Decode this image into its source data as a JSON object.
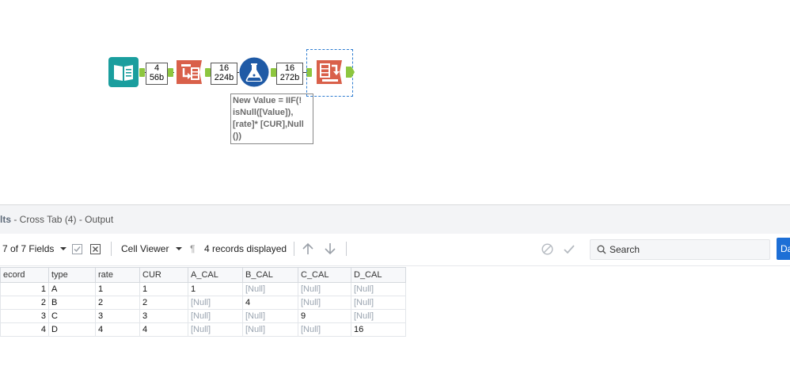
{
  "canvas": {
    "links": [
      {
        "records": "4",
        "size": "56b"
      },
      {
        "records": "16",
        "size": "224b"
      },
      {
        "records": "16",
        "size": "272b"
      }
    ],
    "annotation": "New Value = IIF(!\nisNull([Value]),\n[rate]* [CUR],Null\n())",
    "colors": {
      "input_tool": "#1a9e9e",
      "transform_tool": "#d9604a",
      "formula_tool": "#1f5aa6",
      "connector": "#8dc63f",
      "selection": "#2f7dd1"
    }
  },
  "results": {
    "title_prefix": "lts",
    "title_suffix": " - Cross Tab (4) - Output",
    "toolbar": {
      "fields": "7 of 7 Fields",
      "cell_viewer": "Cell Viewer",
      "records_displayed": "4 records displayed",
      "search_placeholder": "Search",
      "data_button": "Da"
    },
    "columns": [
      "ecord",
      "type",
      "rate",
      "CUR",
      "A_CAL",
      "B_CAL",
      "C_CAL",
      "D_CAL"
    ],
    "rows": [
      [
        "1",
        "A",
        "1",
        "1",
        "1",
        "[Null]",
        "[Null]",
        "[Null]"
      ],
      [
        "2",
        "B",
        "2",
        "2",
        "[Null]",
        "4",
        "[Null]",
        "[Null]"
      ],
      [
        "3",
        "C",
        "3",
        "3",
        "[Null]",
        "[Null]",
        "9",
        "[Null]"
      ],
      [
        "4",
        "D",
        "4",
        "4",
        "[Null]",
        "[Null]",
        "[Null]",
        "16"
      ]
    ]
  }
}
